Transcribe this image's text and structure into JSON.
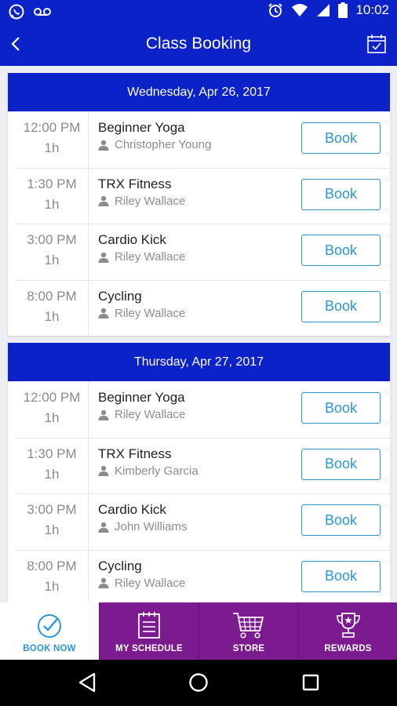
{
  "status_bar": {
    "time": "10:02"
  },
  "app_bar": {
    "title": "Class Booking"
  },
  "days": [
    {
      "date": "Wednesday, Apr 26, 2017",
      "classes": [
        {
          "time": "12:00 PM",
          "duration": "1h",
          "name": "Beginner Yoga",
          "instructor": "Christopher Young",
          "button": "Book"
        },
        {
          "time": "1:30 PM",
          "duration": "1h",
          "name": "TRX Fitness",
          "instructor": "Riley Wallace",
          "button": "Book"
        },
        {
          "time": "3:00 PM",
          "duration": "1h",
          "name": "Cardio Kick",
          "instructor": "Riley Wallace",
          "button": "Book"
        },
        {
          "time": "8:00 PM",
          "duration": "1h",
          "name": "Cycling",
          "instructor": "Riley Wallace",
          "button": "Book"
        }
      ]
    },
    {
      "date": "Thursday, Apr 27, 2017",
      "classes": [
        {
          "time": "12:00 PM",
          "duration": "1h",
          "name": "Beginner Yoga",
          "instructor": "Riley Wallace",
          "button": "Book"
        },
        {
          "time": "1:30 PM",
          "duration": "1h",
          "name": "TRX Fitness",
          "instructor": "Kimberly Garcia",
          "button": "Book"
        },
        {
          "time": "3:00 PM",
          "duration": "1h",
          "name": "Cardio Kick",
          "instructor": "John Williams",
          "button": "Book"
        },
        {
          "time": "8:00 PM",
          "duration": "1h",
          "name": "Cycling",
          "instructor": "Riley Wallace",
          "button": "Book"
        }
      ]
    }
  ],
  "tabs": [
    {
      "label": "BOOK NOW",
      "icon": "check-circle-icon",
      "active": true
    },
    {
      "label": "MY SCHEDULE",
      "icon": "schedule-list-icon",
      "active": false
    },
    {
      "label": "STORE",
      "icon": "cart-icon",
      "active": false
    },
    {
      "label": "REWARDS",
      "icon": "trophy-icon",
      "active": false
    }
  ],
  "colors": {
    "header_blue": "#0a22c7",
    "accent_blue": "#2a96d6",
    "tab_purple": "#7c1a8f"
  }
}
